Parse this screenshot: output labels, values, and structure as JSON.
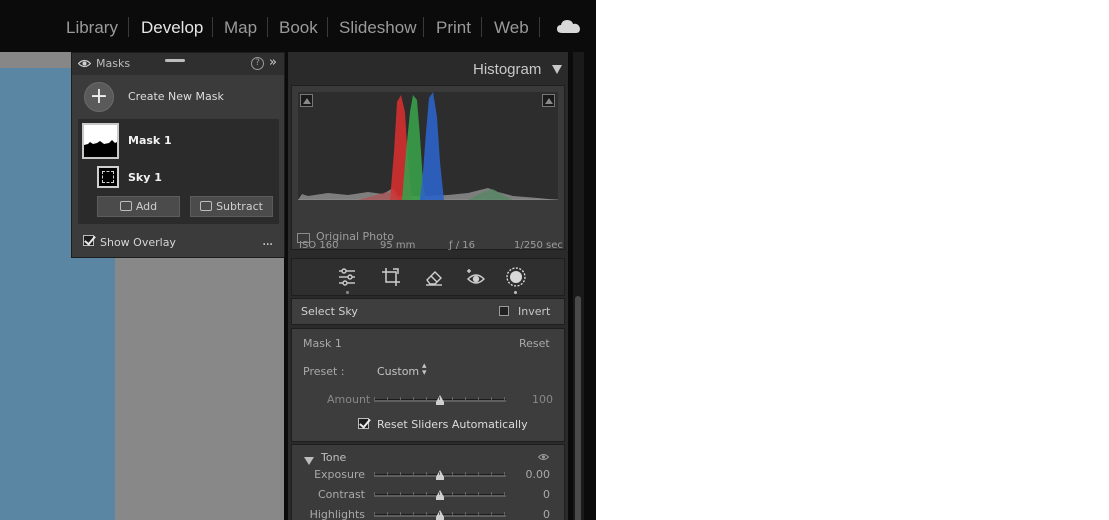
{
  "modules": [
    "Library",
    "Develop",
    "Map",
    "Book",
    "Slideshow",
    "Print",
    "Web"
  ],
  "active_module": "Develop",
  "masks_panel": {
    "title": "Masks",
    "help": "?",
    "collapse": "»",
    "create_label": "Create New Mask",
    "mask_name": "Mask 1",
    "component_name": "Sky 1",
    "add_label": "Add",
    "subtract_label": "Subtract",
    "show_overlay_label": "Show Overlay",
    "more": "..."
  },
  "histogram": {
    "title": "Histogram",
    "iso": "ISO 160",
    "focal": "95 mm",
    "aperture": "ƒ / 16",
    "shutter": "1/250 sec",
    "original_photo_label": "Original Photo"
  },
  "select_sky": {
    "label": "Select Sky",
    "invert_label": "Invert"
  },
  "mask_section": {
    "name": "Mask 1",
    "reset": "Reset",
    "preset_label": "Preset :",
    "preset_value": "Custom",
    "amount_label": "Amount",
    "amount_value": "100",
    "amount_level": 1.0,
    "reset_sliders_label": "Reset Sliders Automatically"
  },
  "tone": {
    "label": "Tone",
    "rows": [
      {
        "label": "Exposure",
        "value": "0.00"
      },
      {
        "label": "Contrast",
        "value": "0"
      },
      {
        "label": "Highlights",
        "value": "0"
      }
    ]
  },
  "colors": {
    "sky_photo": "#5b86a3",
    "hist_red": "#d43030",
    "hist_green": "#39a04a",
    "hist_blue": "#2c63c8"
  }
}
